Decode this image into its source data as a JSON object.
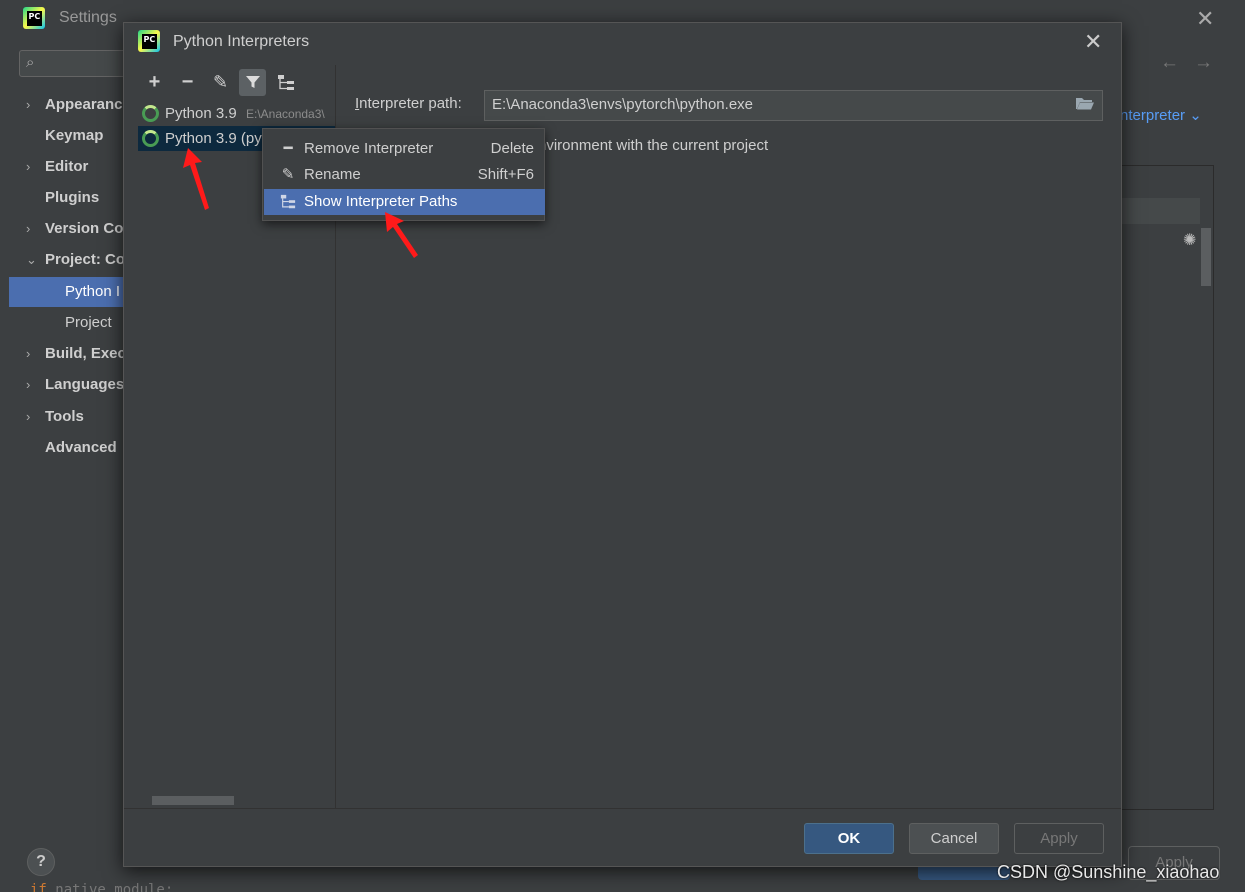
{
  "settings": {
    "title": "Settings",
    "sidebar": [
      {
        "label": "Appearance",
        "chevron": "›"
      },
      {
        "label": "Keymap",
        "chevron": ""
      },
      {
        "label": "Editor",
        "chevron": "›"
      },
      {
        "label": "Plugins",
        "chevron": ""
      },
      {
        "label": "Version Co",
        "chevron": "›"
      },
      {
        "label": "Project: Co",
        "chevron": "⌄"
      },
      {
        "label": "Python I",
        "chevron": ""
      },
      {
        "label": "Project",
        "chevron": ""
      },
      {
        "label": "Build, Exec",
        "chevron": "›"
      },
      {
        "label": "Languages",
        "chevron": "›"
      },
      {
        "label": "Tools",
        "chevron": "›"
      },
      {
        "label": "Advanced",
        "chevron": ""
      }
    ],
    "interpreter_link": "nterpreter",
    "bg_apply_label": "Apply",
    "help_label": "?",
    "bottom_code_keyword": "if",
    "bottom_code_rest": " native_module:"
  },
  "dialog": {
    "title": "Python Interpreters",
    "toolbar": {
      "add": "+",
      "remove": "−",
      "edit": "✎"
    },
    "interpreters": [
      {
        "name": "Python 3.9",
        "path": "E:\\Anaconda3\\"
      },
      {
        "name": "Python 3.9 (py",
        "path": ""
      }
    ],
    "path_label_mnemonic": "I",
    "path_label_rest": "nterpreter path:",
    "path_value": "E:\\Anaconda3\\envs\\pytorch\\python.exe",
    "associate_text": "nvironment with the current project",
    "buttons": {
      "ok": "OK",
      "cancel": "Cancel",
      "apply": "Apply"
    }
  },
  "context_menu": {
    "items": [
      {
        "label": "Remove Interpreter",
        "shortcut": "Delete",
        "icon": "remove-icon"
      },
      {
        "label": "Rename",
        "shortcut": "Shift+F6",
        "icon": "pencil-icon"
      },
      {
        "label": "Show Interpreter Paths",
        "shortcut": "",
        "icon": "tree-icon"
      }
    ]
  },
  "watermark": "CSDN @Sunshine_xiaohao",
  "colors": {
    "accent": "#4b6eaf",
    "annotation": "#ff0000",
    "background": "#3c3f41"
  }
}
